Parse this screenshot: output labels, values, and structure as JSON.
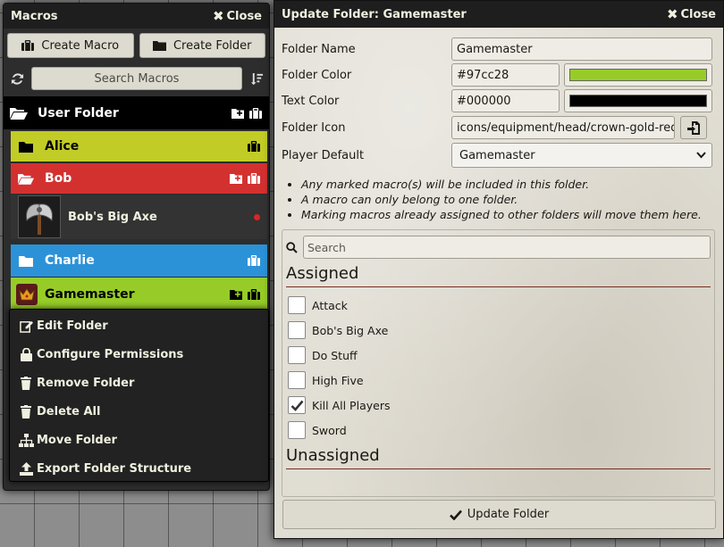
{
  "macros_window": {
    "title": "Macros",
    "close_label": "Close",
    "create_macro_label": "Create Macro",
    "create_folder_label": "Create Folder",
    "search_placeholder": "Search Macros",
    "folders": {
      "user_folder": "User Folder",
      "alice": "Alice",
      "bob": "Bob",
      "bob_macro": "Bob's Big Axe",
      "charlie": "Charlie",
      "gamemaster": "Gamemaster"
    },
    "colors": {
      "user_folder": "#000000",
      "alice": "#c2cc26",
      "bob": "#d33130",
      "charlie": "#2c92d8",
      "gamemaster": "#97cc28"
    }
  },
  "context_menu": {
    "items": [
      {
        "label": "Edit Folder",
        "icon": "edit-icon"
      },
      {
        "label": "Configure Permissions",
        "icon": "lock-icon"
      },
      {
        "label": "Remove Folder",
        "icon": "trash-icon"
      },
      {
        "label": "Delete All",
        "icon": "trash-icon"
      },
      {
        "label": "Move Folder",
        "icon": "sitemap-icon"
      },
      {
        "label": "Export Folder Structure",
        "icon": "upload-icon"
      }
    ]
  },
  "folder_window": {
    "title": "Update Folder: Gamemaster",
    "close_label": "Close",
    "folder_name_label": "Folder Name",
    "folder_name_value": "Gamemaster",
    "folder_color_label": "Folder Color",
    "folder_color_value": "#97cc28",
    "text_color_label": "Text Color",
    "text_color_value": "#000000",
    "folder_icon_label": "Folder Icon",
    "folder_icon_value": "icons/equipment/head/crown-gold-red.w",
    "player_default_label": "Player Default",
    "player_default_value": "Gamemaster",
    "hints": [
      "Any marked macro(s) will be included in this folder.",
      "A macro can only belong to one folder.",
      "Marking macros already assigned to other folders will move them here."
    ],
    "search_placeholder": "Search",
    "assigned_heading": "Assigned",
    "unassigned_heading": "Unassigned",
    "assigned_macros": [
      {
        "label": "Attack",
        "checked": false
      },
      {
        "label": "Bob's Big Axe",
        "checked": false
      },
      {
        "label": "Do Stuff",
        "checked": false
      },
      {
        "label": "High Five",
        "checked": false
      },
      {
        "label": "Kill All Players",
        "checked": true
      },
      {
        "label": "Sword",
        "checked": false
      }
    ],
    "submit_label": "Update Folder"
  }
}
